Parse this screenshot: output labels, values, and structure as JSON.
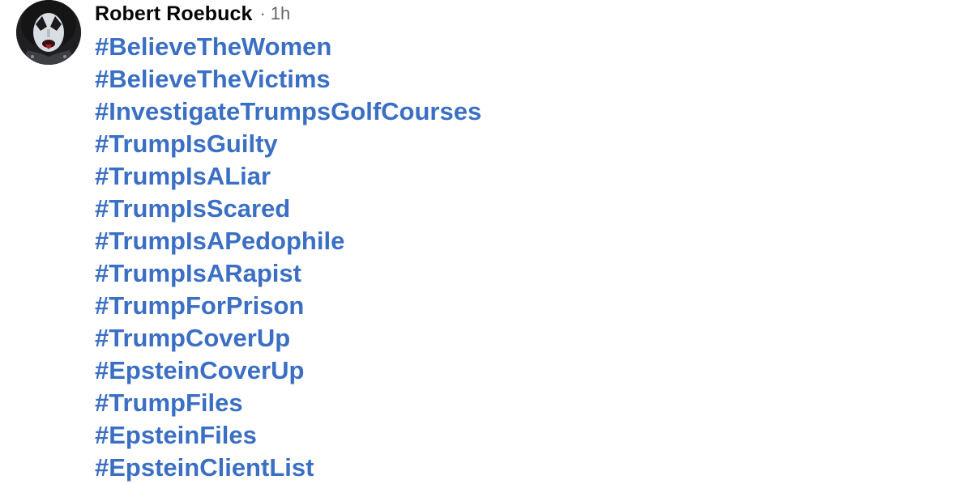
{
  "post": {
    "author": "Robert Roebuck",
    "separator": "·",
    "time": "1h",
    "avatar_icon": "profile-avatar",
    "hashtags": [
      "#BelieveTheWomen",
      "#BelieveTheVictims",
      "#InvestigateTrumpsGolfCourses",
      "#TrumpIsGuilty",
      "#TrumpIsALiar",
      "#TrumpIsScared",
      "#TrumpIsAPedophile",
      "#TrumpIsARapist",
      "#TrumpForPrison",
      "#TrumpCoverUp",
      "#EpsteinCoverUp",
      "#TrumpFiles",
      "#EpsteinFiles",
      "#EpsteinClientList"
    ]
  },
  "colors": {
    "hashtag": "#3b6fc4",
    "author": "#050505",
    "meta": "#65676b",
    "background": "#ffffff"
  }
}
